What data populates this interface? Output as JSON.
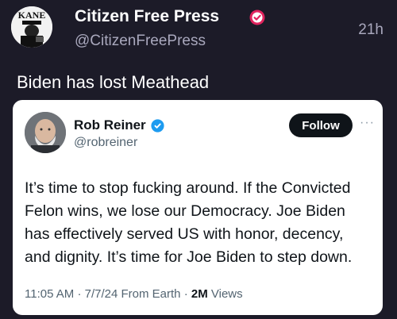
{
  "post": {
    "author": {
      "display_name": "Citizen Free Press",
      "handle": "@CitizenFreePress",
      "avatar_text": "KANE",
      "verified": true
    },
    "age": "21h",
    "text": "Biden has lost Meathead"
  },
  "quote": {
    "author": {
      "display_name": "Rob Reiner",
      "handle": "@robreiner",
      "verified": true
    },
    "follow_label": "Follow",
    "more_icon": "···",
    "lines": [
      "It’s time to stop fucking around. If the Convicted",
      "Felon wins, we lose our Democracy. Joe Biden",
      "has effectively served US with honor, decency,",
      "and dignity. It’s time for Joe Biden to step down."
    ],
    "meta": {
      "time": "11:05 AM",
      "date": "7/7/24",
      "source": "From Earth",
      "views_count": "2M",
      "views_label": "Views"
    }
  },
  "colors": {
    "background": "#1c1b28",
    "verified_badge_outer": "#e0245e",
    "verified_badge_inner": "#1d9bf0"
  },
  "icons": [
    "kane-avatar",
    "verified-badge-icon",
    "verified-badge-icon",
    "rob-reiner-avatar",
    "more-options-icon"
  ]
}
